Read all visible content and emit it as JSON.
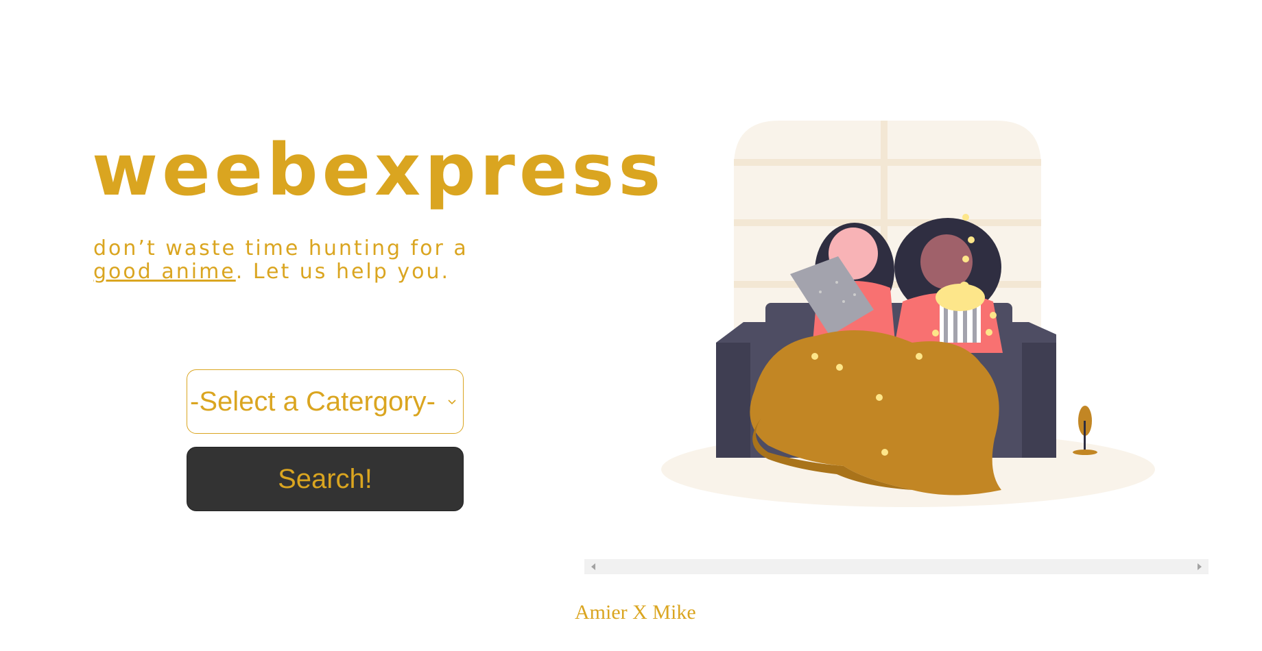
{
  "brand": {
    "title": "weebexpress",
    "tagline_before": "don’t waste time hunting for a ",
    "tagline_link": "good anime",
    "tagline_after": ". Let us help you."
  },
  "form": {
    "category_selected": "-Select a Catergory-",
    "search_label": "Search!"
  },
  "footer": {
    "credit": "Amier X Mike"
  },
  "colors": {
    "accent": "#DAA520",
    "button_bg": "#333333",
    "page_bg": "#ffffff"
  },
  "illustration": {
    "subject": "two women watching a movie on a couch under a blanket with popcorn"
  }
}
